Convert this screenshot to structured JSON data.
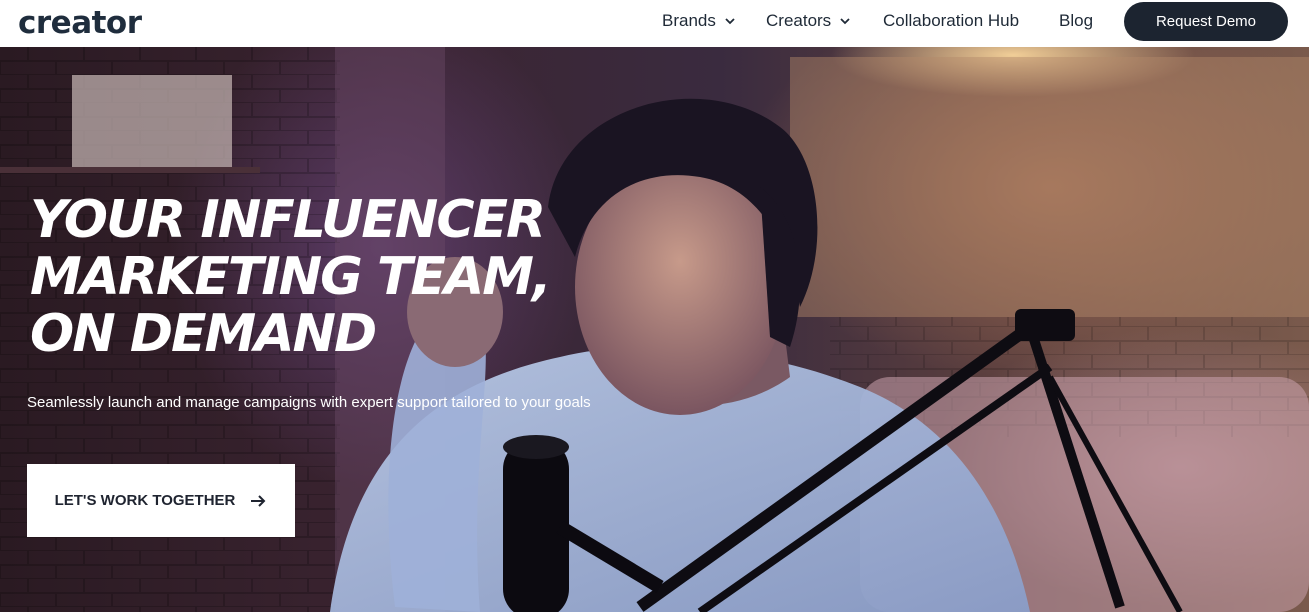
{
  "header": {
    "logo_text": "creator",
    "nav": [
      {
        "label": "Brands",
        "dropdown": true
      },
      {
        "label": "Creators",
        "dropdown": true
      },
      {
        "label": "Collaboration Hub",
        "dropdown": false
      },
      {
        "label": "Blog",
        "dropdown": false
      }
    ],
    "cta_label": "Request Demo"
  },
  "hero": {
    "headline_lines": [
      "YOUR INFLUENCER",
      "MARKETING TEAM,",
      "ON DEMAND"
    ],
    "subtitle": "Seamlessly launch and manage campaigns with expert support tailored to your goals",
    "cta_label": "LET'S WORK TOGETHER",
    "cta_icon": "arrow-right-icon"
  },
  "colors": {
    "header_bg": "#ffffff",
    "text_dark": "#1f2a37",
    "demo_button_bg": "#1c2430",
    "logo_accent": "#ff4b6e"
  }
}
